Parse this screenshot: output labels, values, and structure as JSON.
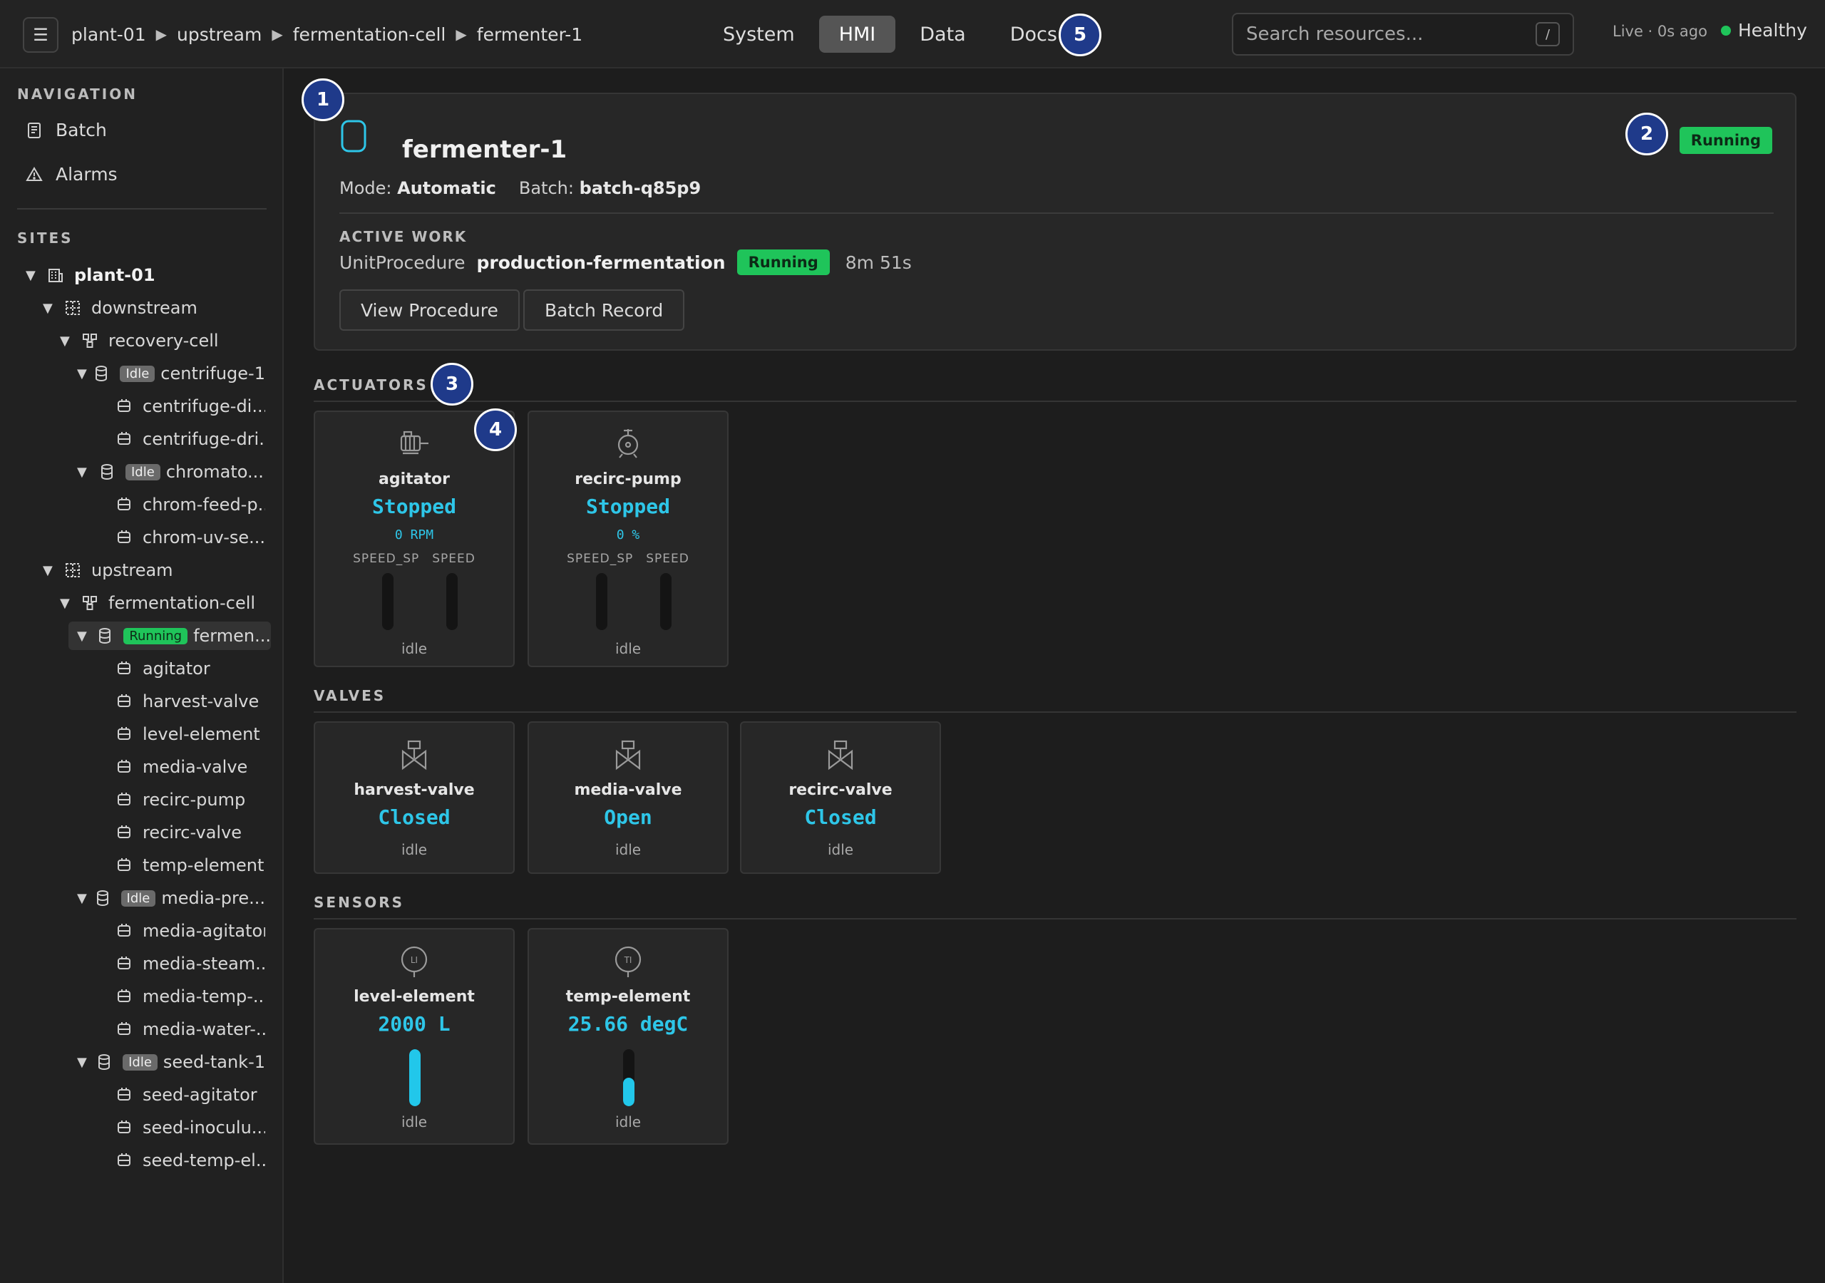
{
  "topbar": {
    "menu_icon": "hamburger-icon",
    "breadcrumb": [
      "plant-01",
      "upstream",
      "fermentation-cell",
      "fermenter-1"
    ],
    "breadcrumb_sep": "▶",
    "tabs": [
      {
        "label": "System",
        "active": false
      },
      {
        "label": "HMI",
        "active": true
      },
      {
        "label": "Data",
        "active": false
      },
      {
        "label": "Docs",
        "active": false
      }
    ],
    "search_placeholder": "Search resources...",
    "search_shortcut": "/",
    "live_text": "Live · 0s ago",
    "health_text": "Healthy",
    "health_color": "#1fc45a"
  },
  "sidebar": {
    "navigation_title": "NAVIGATION",
    "nav_items": [
      {
        "label": "Batch",
        "icon": "document-icon"
      },
      {
        "label": "Alarms",
        "icon": "warning-icon"
      }
    ],
    "sites_title": "SITES",
    "tree": [
      {
        "label": "plant-01",
        "level": 0,
        "type": "site",
        "expanded": true,
        "bold": true
      },
      {
        "label": "downstream",
        "level": 1,
        "type": "area",
        "expanded": true
      },
      {
        "label": "recovery-cell",
        "level": 2,
        "type": "cell",
        "expanded": true
      },
      {
        "label": "centrifuge-1",
        "level": 3,
        "type": "unit",
        "expanded": true,
        "badge": "Idle"
      },
      {
        "label": "centrifuge-di...",
        "level": 4,
        "type": "module"
      },
      {
        "label": "centrifuge-dri...",
        "level": 4,
        "type": "module"
      },
      {
        "label": "chromato...",
        "level": 3,
        "type": "unit",
        "expanded": true,
        "badge": "Idle"
      },
      {
        "label": "chrom-feed-p...",
        "level": 4,
        "type": "module"
      },
      {
        "label": "chrom-uv-se...",
        "level": 4,
        "type": "module"
      },
      {
        "label": "upstream",
        "level": 1,
        "type": "area",
        "expanded": true
      },
      {
        "label": "fermentation-cell",
        "level": 2,
        "type": "cell",
        "expanded": true
      },
      {
        "label": "fermen...",
        "level": 3,
        "type": "unit",
        "expanded": true,
        "badge": "Running",
        "selected": true
      },
      {
        "label": "agitator",
        "level": 4,
        "type": "module"
      },
      {
        "label": "harvest-valve",
        "level": 4,
        "type": "module"
      },
      {
        "label": "level-element",
        "level": 4,
        "type": "module"
      },
      {
        "label": "media-valve",
        "level": 4,
        "type": "module"
      },
      {
        "label": "recirc-pump",
        "level": 4,
        "type": "module"
      },
      {
        "label": "recirc-valve",
        "level": 4,
        "type": "module"
      },
      {
        "label": "temp-element",
        "level": 4,
        "type": "module"
      },
      {
        "label": "media-pre...",
        "level": 3,
        "type": "unit",
        "expanded": true,
        "badge": "Idle"
      },
      {
        "label": "media-agitator",
        "level": 4,
        "type": "module"
      },
      {
        "label": "media-steam...",
        "level": 4,
        "type": "module"
      },
      {
        "label": "media-temp-...",
        "level": 4,
        "type": "module"
      },
      {
        "label": "media-water-...",
        "level": 4,
        "type": "module"
      },
      {
        "label": "seed-tank-1",
        "level": 3,
        "type": "unit",
        "expanded": true,
        "badge": "Idle"
      },
      {
        "label": "seed-agitator",
        "level": 4,
        "type": "module"
      },
      {
        "label": "seed-inoculu...",
        "level": 4,
        "type": "module"
      },
      {
        "label": "seed-temp-el...",
        "level": 4,
        "type": "module"
      }
    ]
  },
  "unit": {
    "icon": "vessel-icon",
    "title": "fermenter-1",
    "status": "Running",
    "mode_label": "Mode:",
    "mode_value": "Automatic",
    "batch_label": "Batch:",
    "batch_value": "batch-q85p9",
    "active_work_title": "ACTIVE WORK",
    "active_type": "UnitProcedure",
    "active_name": "production-fermentation",
    "active_status": "Running",
    "active_elapsed": "8m 51s",
    "btn_view": "View Procedure",
    "btn_record": "Batch Record"
  },
  "sections": {
    "actuators": "ACTUATORS",
    "valves": "VALVES",
    "sensors": "SENSORS"
  },
  "actuators": [
    {
      "name": "agitator",
      "icon": "motor-icon",
      "state": "Stopped",
      "value": "0 RPM",
      "labels": [
        "SPEED_SP",
        "SPEED"
      ],
      "mode": "idle"
    },
    {
      "name": "recirc-pump",
      "icon": "pump-icon",
      "state": "Stopped",
      "value": "0 %",
      "labels": [
        "SPEED_SP",
        "SPEED"
      ],
      "mode": "idle"
    }
  ],
  "valves": [
    {
      "name": "harvest-valve",
      "icon": "valve-icon",
      "state": "Closed",
      "mode": "idle"
    },
    {
      "name": "media-valve",
      "icon": "valve-icon",
      "state": "Open",
      "mode": "idle"
    },
    {
      "name": "recirc-valve",
      "icon": "valve-icon",
      "state": "Closed",
      "mode": "idle"
    }
  ],
  "sensors": [
    {
      "name": "level-element",
      "icon": "level-indicator-icon",
      "tag": "LI",
      "state": "2000 L",
      "fill_pct": 100,
      "mode": "idle"
    },
    {
      "name": "temp-element",
      "icon": "temp-indicator-icon",
      "tag": "TI",
      "state": "25.66 degC",
      "fill_pct": 50,
      "mode": "idle"
    }
  ],
  "callouts": [
    "1",
    "2",
    "3",
    "4",
    "5"
  ],
  "colors": {
    "accent_cyan": "#2ec6e8",
    "running_green": "#1fc45a",
    "idle_gray": "#6a6a6a",
    "callout_blue": "#1f3a8a"
  }
}
